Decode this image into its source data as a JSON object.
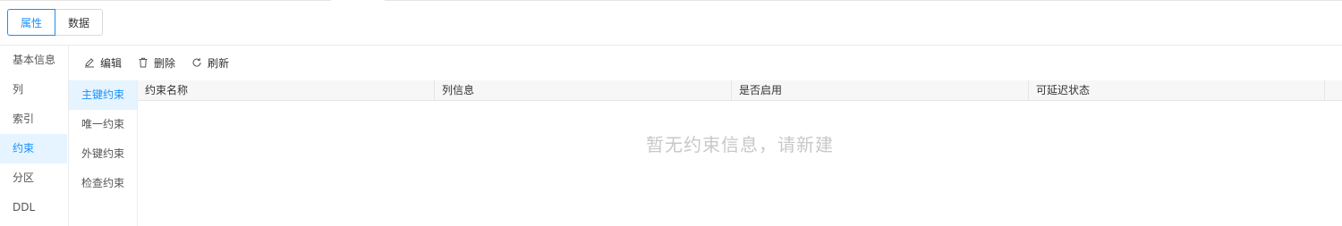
{
  "view_tabs": [
    {
      "label": "属性",
      "active": true
    },
    {
      "label": "数据",
      "active": false
    }
  ],
  "sidebar": {
    "items": [
      {
        "label": "基本信息",
        "active": false
      },
      {
        "label": "列",
        "active": false
      },
      {
        "label": "索引",
        "active": false
      },
      {
        "label": "约束",
        "active": true
      },
      {
        "label": "分区",
        "active": false
      },
      {
        "label": "DDL",
        "active": false
      }
    ]
  },
  "toolbar": {
    "edit_label": "编辑",
    "edit_icon": "pencil-icon",
    "delete_label": "删除",
    "delete_icon": "trash-icon",
    "refresh_label": "刷新",
    "refresh_icon": "refresh-icon"
  },
  "constraint_types": {
    "items": [
      {
        "label": "主键约束",
        "active": true
      },
      {
        "label": "唯一约束",
        "active": false
      },
      {
        "label": "外键约束",
        "active": false
      },
      {
        "label": "检查约束",
        "active": false
      }
    ]
  },
  "table": {
    "columns": [
      "约束名称",
      "列信息",
      "是否启用",
      "可延迟状态"
    ],
    "empty_text": "暂无约束信息，请新建"
  },
  "colors": {
    "accent": "#1890ff",
    "active_bg": "#e6f4ff",
    "header_bg": "#f7f7f7",
    "empty_text": "#c8c8c8"
  }
}
